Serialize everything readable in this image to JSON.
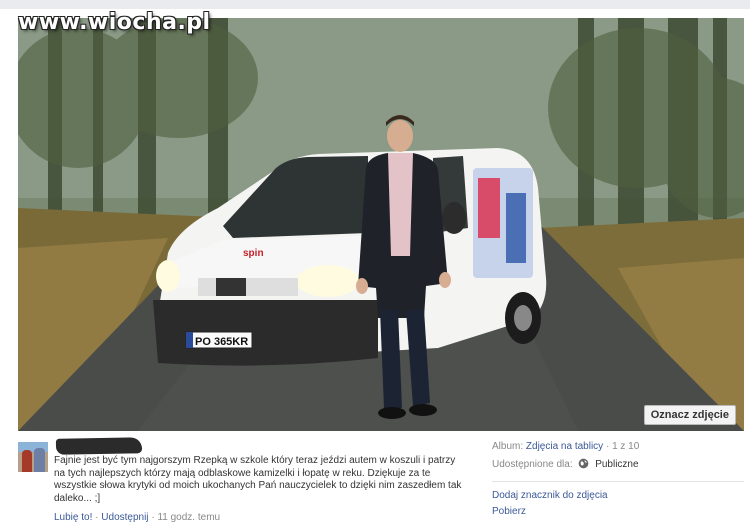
{
  "watermark": "www.wiocha.pl",
  "photo": {
    "license_plate": "PO 365KR",
    "van_logo": "spin",
    "tag_button": "Oznacz zdjęcie"
  },
  "post": {
    "caption": "Fajnie jest być tym najgorszym Rzepką w szkole który teraz jeździ autem w koszuli i patrzy na tych najlepszych którzy mają odblaskowe kamizelki i łopatę w reku. Dziękuje za te wszystkie słowa krytyki od moich ukochanych Pań nauczycielek to dzięki nim zaszedłem tak daleko... ;]",
    "like_label": "Lubię to!",
    "share_label": "Udostępnij",
    "time": "11 godz. temu",
    "sep": "·"
  },
  "meta": {
    "album_label": "Album:",
    "album_link": "Zdjęcia na tablicy",
    "album_count": "1 z 10",
    "shared_label": "Udostępnione dla:",
    "shared_value": "Publiczne",
    "add_location": "Dodaj znacznik do zdjęcia",
    "download": "Pobierz"
  },
  "colors": {
    "link": "#3b5998",
    "muted": "#888888"
  }
}
